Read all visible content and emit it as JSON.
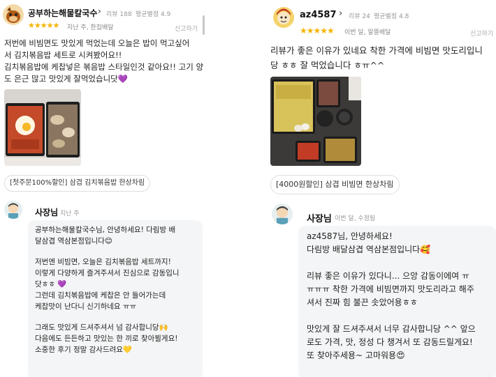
{
  "left": {
    "user": {
      "name": "공부하는해물칼국수",
      "review_count": "리뷰 188",
      "avg_rating": "평균별점 4.9"
    },
    "rating": {
      "stars": "★★★★★",
      "when": "지난 주, 한집배달"
    },
    "report": "신고하기",
    "review_lines": [
      "저번에 비빔면도 맛있게 먹었는데 오늘은 밥이 먹고싶어",
      "서 김치볶음밥 세트로 시켜봤어요!!",
      "김치볶음밥에 케찹넣은 볶음밥 스타일인것 같아요!! 고기 양",
      "도 은근 많고 맛있게 잘먹었습니닷💜"
    ],
    "order_chip": "[첫주문100%할인] 삼겹 김치볶음밥 한상차림",
    "owner": {
      "name": "사장님",
      "when": "지난 주"
    },
    "reply_lines": [
      "공부하는해물칼국수님, 안녕하세요! 다림방 배",
      "달삼겹 역삼본점입니다😊",
      "",
      "저번엔 비빔면, 오늘은 김치볶음밥 세트까지!",
      "이렇게 다양하게 즐겨주셔서 진심으로 감동입니",
      "닷ㅎㅎ 💜",
      "그런데 김치볶음밥에 케찹은 안 들어가는데",
      "케찹맛이 난다니 신기하네요 ㅠㅠ",
      "",
      "그래도 맛있게 드셔주셔서 넘 감사합니당🙌",
      "다음에도 든든하고 맛있는 한 끼로 찾아뵐게요!",
      "소중한 후기 정말 감사드려요💛"
    ]
  },
  "right": {
    "user": {
      "name": "az4587",
      "review_count": "리뷰 24",
      "avg_rating": "평균별점 4.8"
    },
    "rating": {
      "stars": "★★★★★",
      "when": "이번 달, 알뜰배달"
    },
    "report": "신고하기",
    "review_lines": [
      "리뷰가 좋은 이유가 있네요 착한 가격에 비빔면 맛도리입니",
      "당 ㅎㅎ 잘 먹었습니다 ㅎㅠ^^"
    ],
    "order_chip": "[4000원할인] 삼겹 비빔면 한상차림",
    "owner": {
      "name": "사장님",
      "when": "이번 달, 수정됨"
    },
    "reply_lines": [
      "az4587님, 안녕하세요!",
      "다림방 배달삼겹 역삼본점입니다🥰",
      "",
      "리뷰 좋은 이유가 있다니... 으앙 감동이에여 ㅠ",
      "ㅠㅠㅠ 착한 가격에 비빔면까지 맛도리라고 해주",
      "셔서 진짜 힘 불끈 솟았어용ㅎㅎ",
      "",
      "맛있게 잘 드셔주셔서 너무 감사합니당 ^^ 앞으",
      "로도 가격, 맛, 정성 다 챙겨서 또 감동드릴게요!",
      "또 찾아주세용~ 고마워용😍"
    ]
  },
  "colors": {
    "star": "#f5b400",
    "bubble": "#f4f5f6",
    "meta": "#999999"
  }
}
